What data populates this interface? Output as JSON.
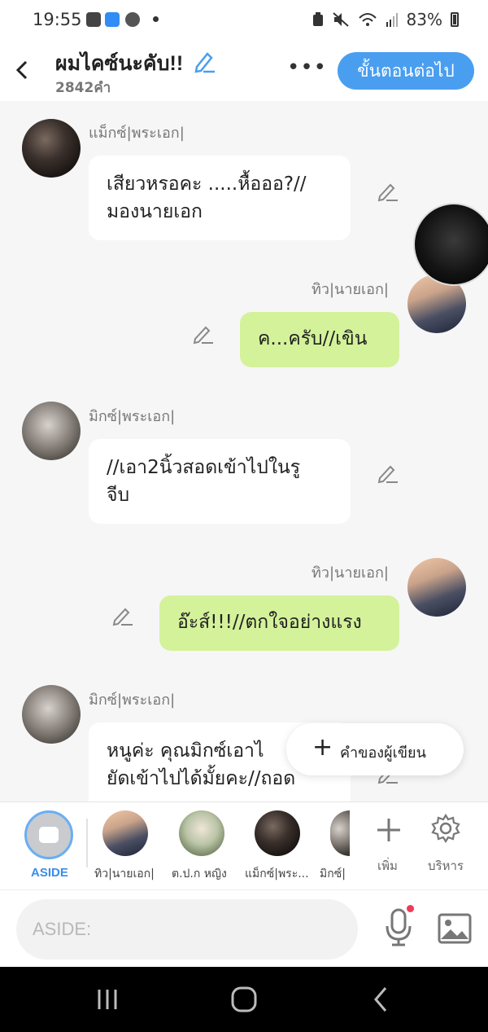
{
  "status_bar": {
    "time": "19:55",
    "battery": "83%"
  },
  "header": {
    "title": "ผมไคซ์นะคับ!!",
    "word_count": "2842คำ",
    "more": "•••",
    "next_button": "ขั้นตอนต่อไป"
  },
  "messages": [
    {
      "side": "left",
      "sender": "แม็กซ์|พระเอก|",
      "lines": [
        "เสียวหรอคะ .....หื้อออ?//",
        "มองนายเอก"
      ]
    },
    {
      "side": "right",
      "sender": "ทิว|นายเอก|",
      "lines": [
        "ค...ครับ//เขิน"
      ]
    },
    {
      "side": "left",
      "sender": "มิกซ์|พระเอก|",
      "lines": [
        "//เอา2นิ้วสอดเข้าไปในรู",
        "จีบ"
      ]
    },
    {
      "side": "right",
      "sender": "ทิว|นายเอก|",
      "lines": [
        "อ๊ะส์!!!//ตกใจอย่างแรง"
      ]
    },
    {
      "side": "left",
      "sender": "มิกซ์|พระเอก|",
      "lines": [
        "หนูค่ะ คุณมิกซ์เอาไ",
        "ยัดเข้าไปได้มั้ยคะ//ถอด"
      ]
    }
  ],
  "writer_words_button": "คำของผู้เขียน",
  "character_bar": {
    "aside_label": "ASIDE",
    "characters": [
      "ทิว|นายเอก|",
      "ต.ป.ก หญิง",
      "แม็กซ์|พระ...",
      "มิกซ์|"
    ],
    "add_label": "เพิ่ม",
    "manage_label": "บริหาร"
  },
  "input": {
    "placeholder": "ASIDE:"
  },
  "colors": {
    "accent": "#4a9ef0",
    "right_bubble": "#d4f29a",
    "left_bubble": "#ffffff",
    "background": "#f6f6f7"
  }
}
